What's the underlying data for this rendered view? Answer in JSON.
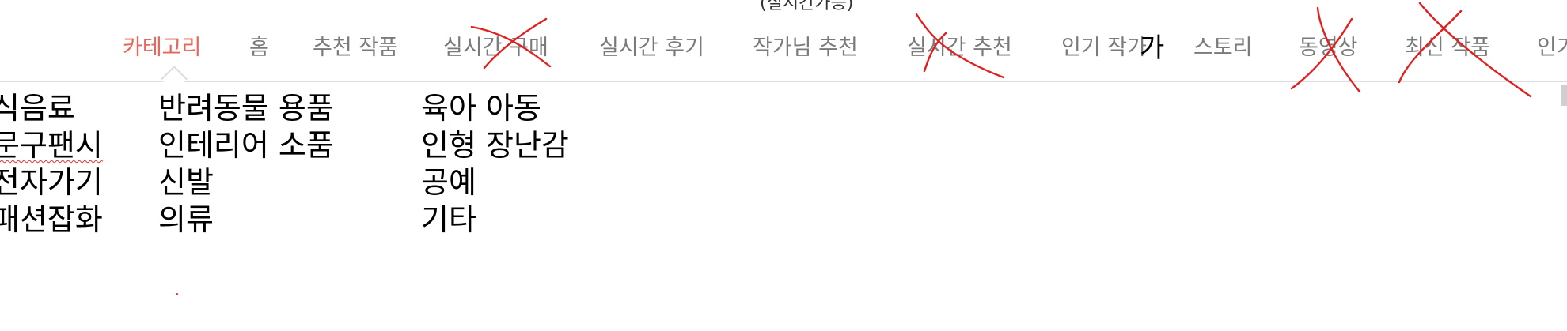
{
  "header_note": "(실시간가능)",
  "tabs": [
    {
      "label": "카테고리",
      "active": true
    },
    {
      "label": "홈",
      "active": false
    },
    {
      "label": "추천 작품",
      "active": false
    },
    {
      "label": "실시간 구매",
      "active": false,
      "crossed_out": true
    },
    {
      "label": "실시간 후기",
      "active": false
    },
    {
      "label": "작가님 추천",
      "active": false
    },
    {
      "label": "실시간 추천",
      "active": false,
      "crossed_out": true
    },
    {
      "label": "인기 작가",
      "active": false
    },
    {
      "label": "스토리",
      "active": false
    },
    {
      "label": "동영상",
      "active": false,
      "crossed_out": true
    },
    {
      "label": "최신 작품",
      "active": false,
      "crossed_out": true
    },
    {
      "label": "인기",
      "active": false
    }
  ],
  "annotations": {
    "handwritten_char": "가"
  },
  "categories": {
    "col1": [
      "식음료",
      "문구팬시",
      "전자가기",
      "패션잡화"
    ],
    "col2": [
      "반려동물 용품",
      "인테리어 소품",
      "신발",
      "의류"
    ],
    "col3": [
      "육아 아동",
      "인형 장난감",
      "공예",
      "기타"
    ]
  },
  "colors": {
    "active_tab": "#e8655a",
    "inactive_tab": "#7a7a7a",
    "strike": "#e02020",
    "divider": "#dddddd"
  }
}
